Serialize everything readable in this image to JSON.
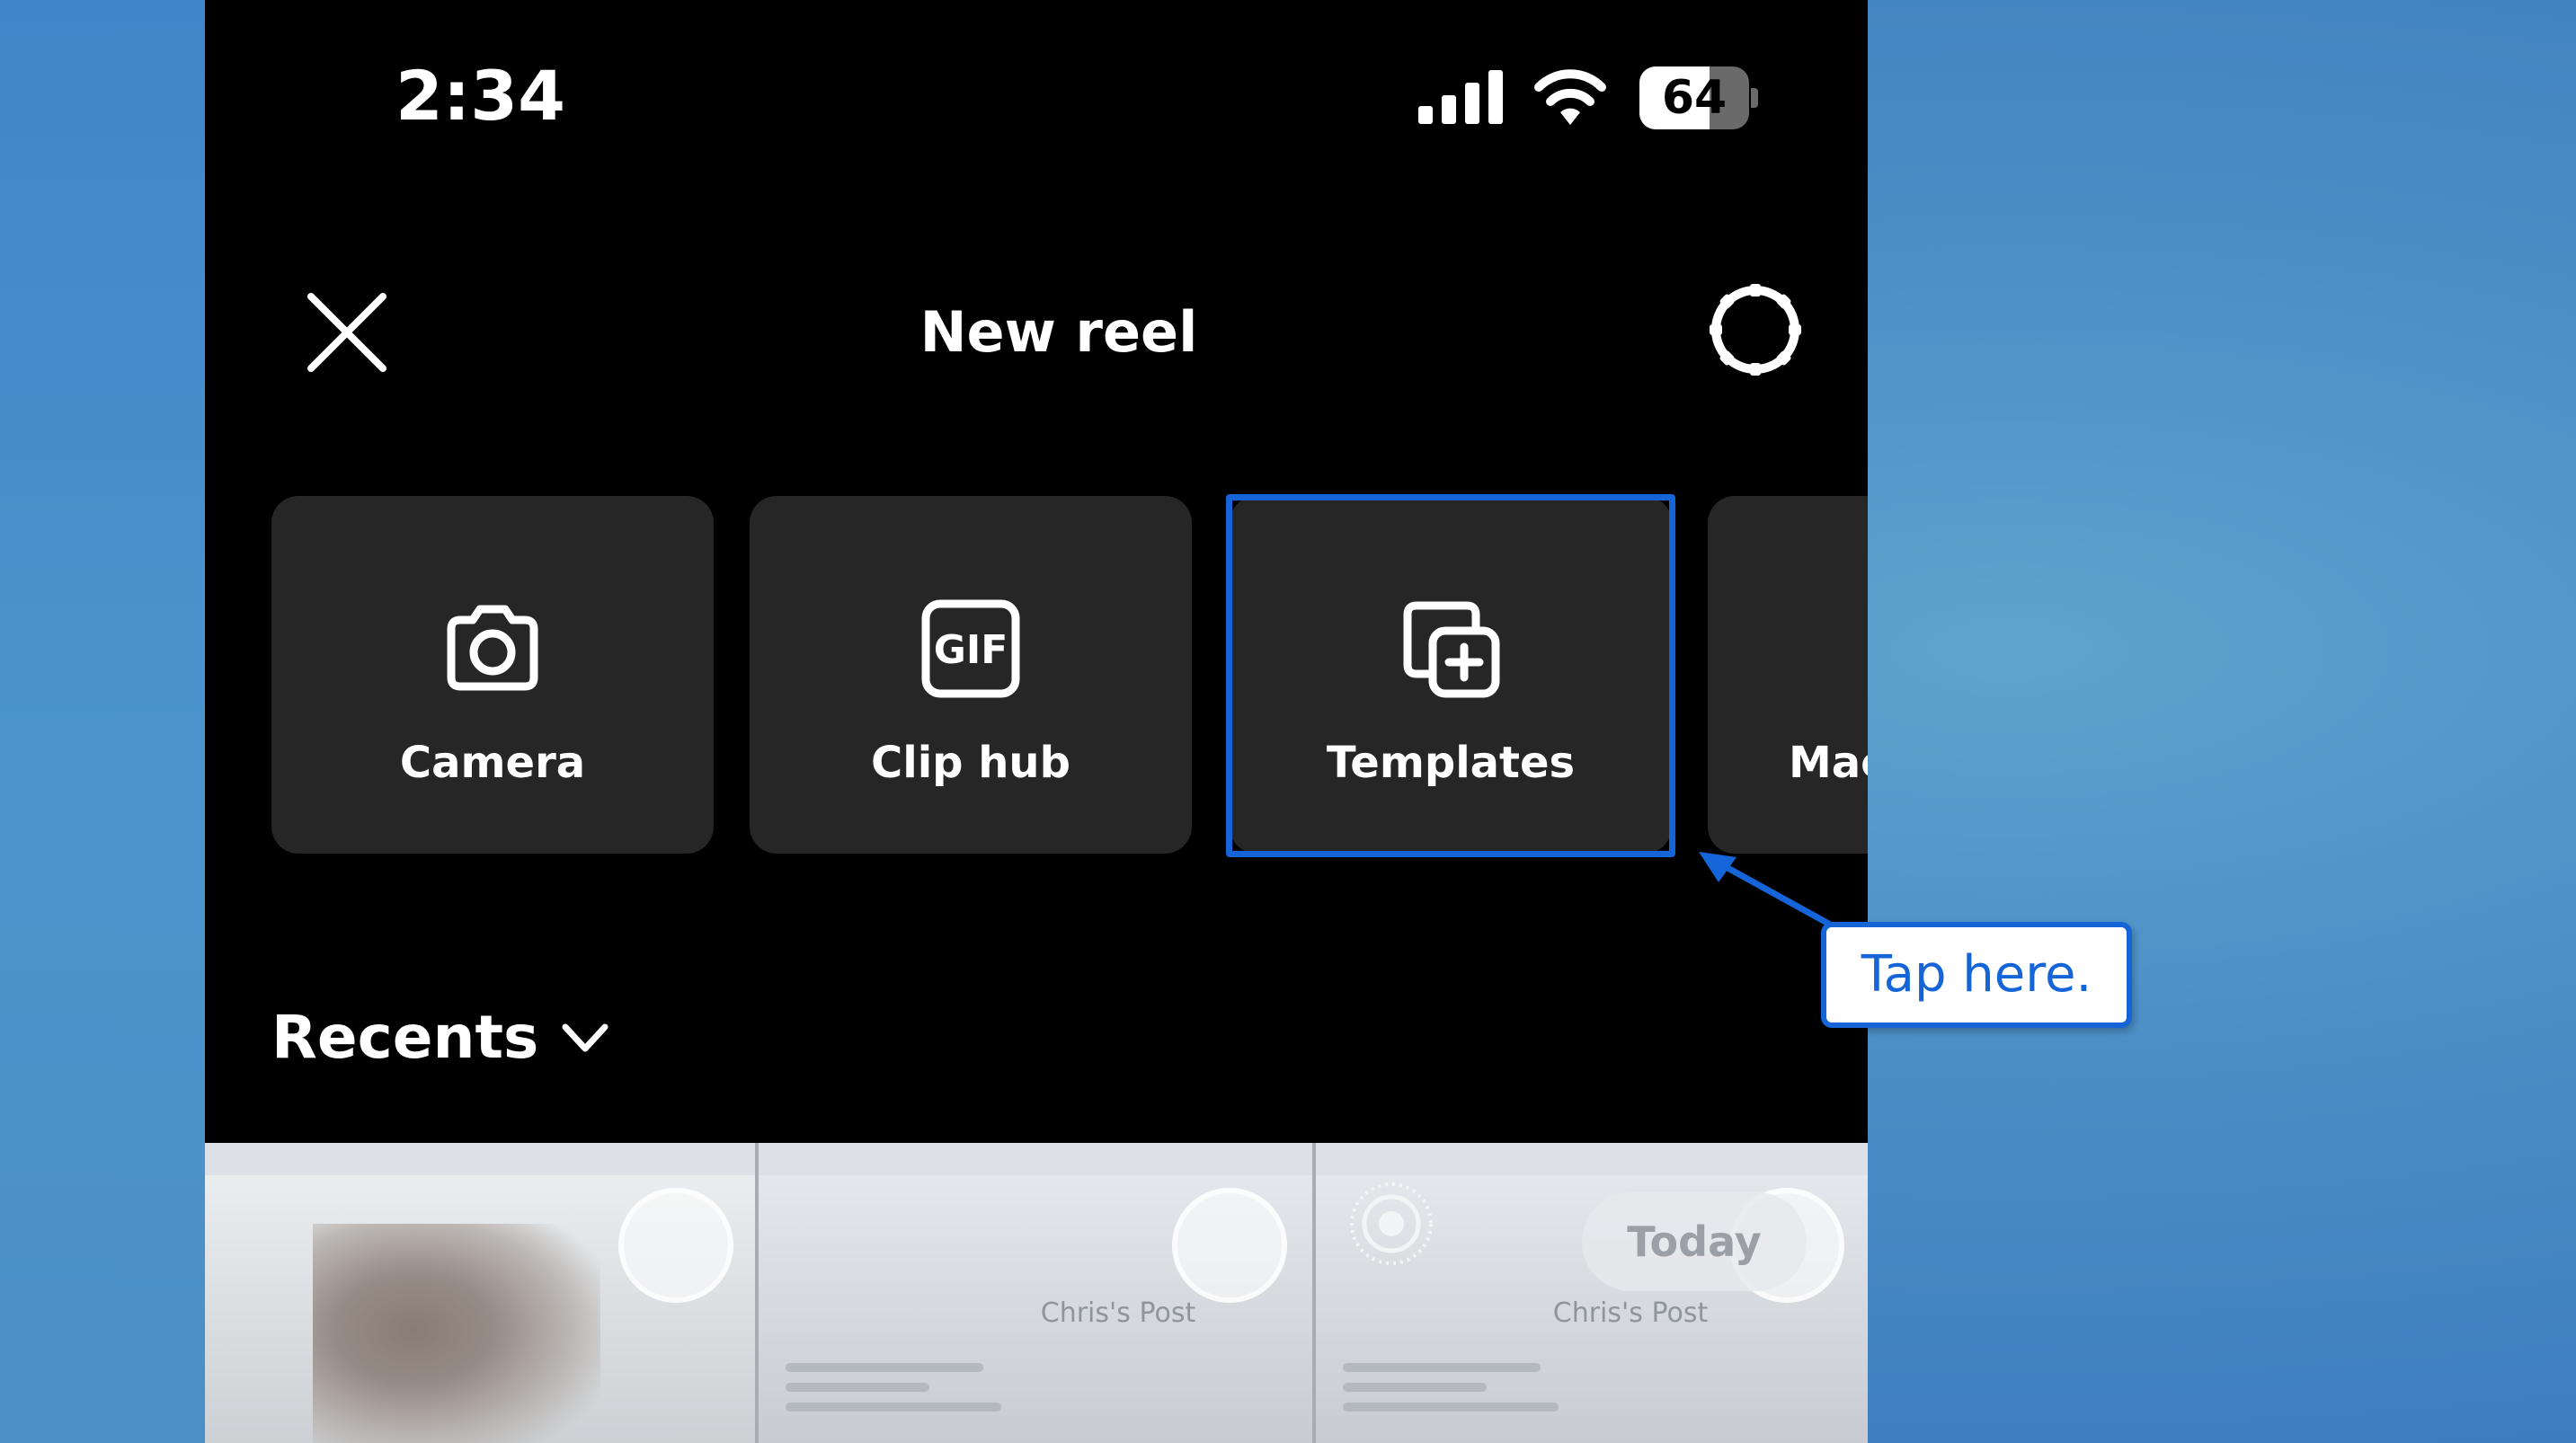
{
  "status_bar": {
    "time": "2:34",
    "battery_level": "64",
    "battery_fraction": 0.64,
    "icons": [
      "signal-icon",
      "wifi-icon",
      "battery-icon"
    ]
  },
  "header": {
    "title": "New reel",
    "close_icon": "close-icon",
    "settings_icon": "settings-icon"
  },
  "create_options": [
    {
      "label": "Camera",
      "icon": "camera-icon"
    },
    {
      "label": "Clip hub",
      "icon": "gif-icon",
      "icon_text": "GIF"
    },
    {
      "label": "Templates",
      "icon": "templates-icon"
    },
    {
      "label": "Mac",
      "icon": null
    }
  ],
  "highlighted_option": "Templates",
  "recents": {
    "label": "Recents",
    "icon": "chevron-down-icon"
  },
  "gallery": {
    "thumb_3_badge": "Today",
    "post_title_2": "Chris's Post",
    "post_title_3": "Chris's Post"
  },
  "callout": {
    "text": "Tap here."
  },
  "colors": {
    "accent": "#1565d8",
    "tile_bg": "#262626",
    "screen_bg": "#000000"
  }
}
